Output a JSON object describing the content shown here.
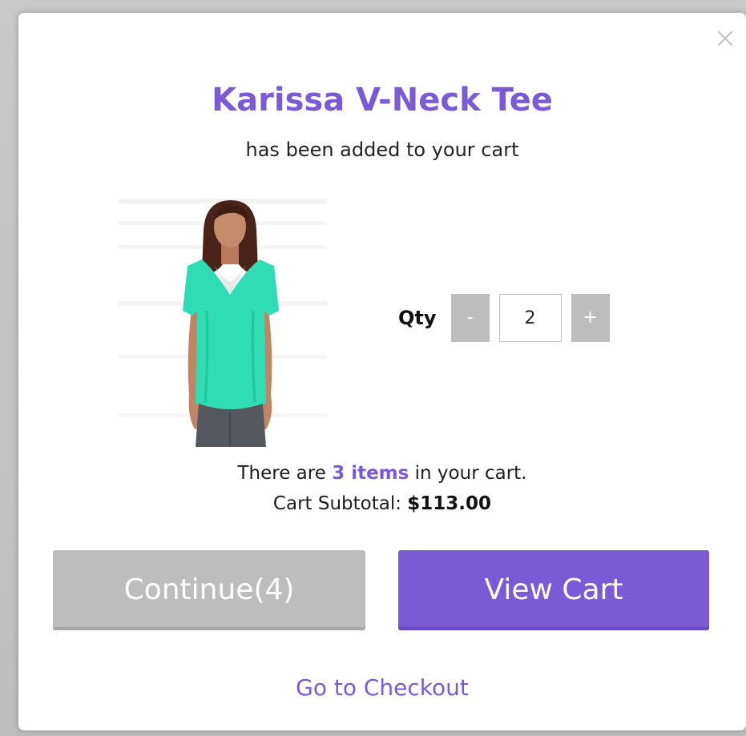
{
  "modal": {
    "close_icon": "close-icon",
    "title": "Karissa V-Neck Tee",
    "subtitle": "has been added to your cart"
  },
  "product": {
    "image_icon": "product-image",
    "shirt_color": "#2fdcb4"
  },
  "quantity": {
    "label": "Qty",
    "decrement_label": "-",
    "value": "2",
    "increment_label": "+"
  },
  "cart": {
    "line1_prefix": "There are ",
    "item_count": "3 items",
    "line1_suffix": " in your cart.",
    "subtotal_label": "Cart Subtotal: ",
    "subtotal_value": "$113.00"
  },
  "actions": {
    "continue_label": "Continue(4)",
    "view_cart_label": "View Cart",
    "checkout_label": "Go to Checkout"
  },
  "colors": {
    "accent": "#7b5ad6",
    "button_gray": "#bdbdbd",
    "backdrop": "#bdbdbd"
  }
}
